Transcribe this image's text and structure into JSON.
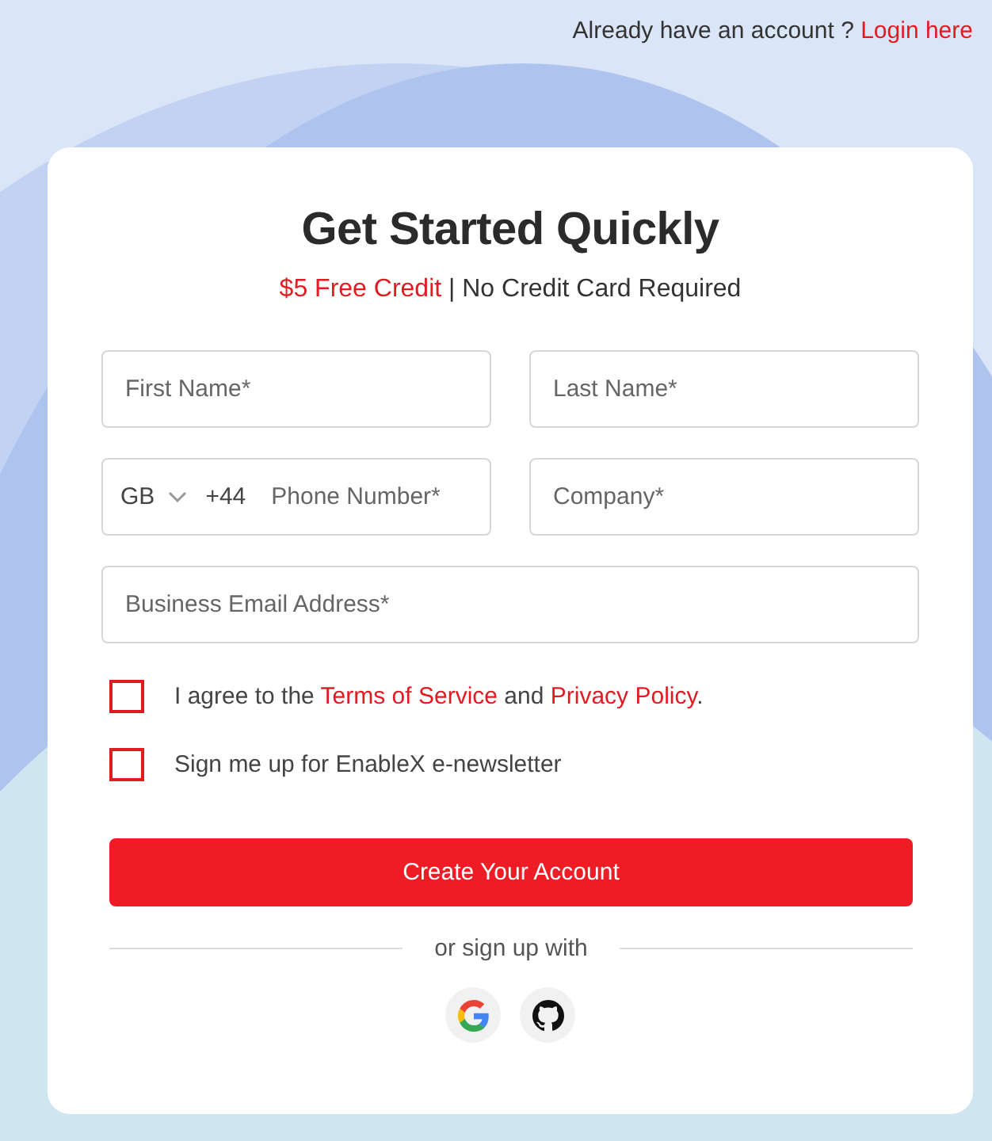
{
  "top_bar": {
    "prompt": "Already have an account ?",
    "link": "Login here"
  },
  "form": {
    "title": "Get Started Quickly",
    "subtitle": {
      "highlight": "$5 Free Credit",
      "separator": "|",
      "text": "No Credit Card Required"
    },
    "fields": [
      {
        "kind": "text",
        "placeholder": "First Name*"
      },
      {
        "kind": "text",
        "placeholder": "Last Name*"
      },
      {
        "kind": "phone",
        "country": "GB",
        "code": "+44",
        "placeholder": "Phone Number*"
      },
      {
        "kind": "text",
        "placeholder": "Company*"
      },
      {
        "kind": "wide",
        "placeholder": "Business Email Address*"
      }
    ],
    "checkboxes": [
      {
        "checked": false,
        "parts": [
          {
            "text": "I agree to the ",
            "link": false
          },
          {
            "text": "Terms of Service",
            "link": true
          },
          {
            "text": " and ",
            "link": false
          },
          {
            "text": "Privacy Policy",
            "link": true
          },
          {
            "text": ".",
            "link": false
          }
        ]
      },
      {
        "checked": false,
        "parts": [
          {
            "text": "Sign me up for EnableX e-newsletter",
            "link": false
          }
        ]
      }
    ],
    "submit": "Create Your Account",
    "divider": "or sign up with",
    "social": [
      {
        "kind": "google"
      },
      {
        "kind": "github"
      }
    ]
  }
}
